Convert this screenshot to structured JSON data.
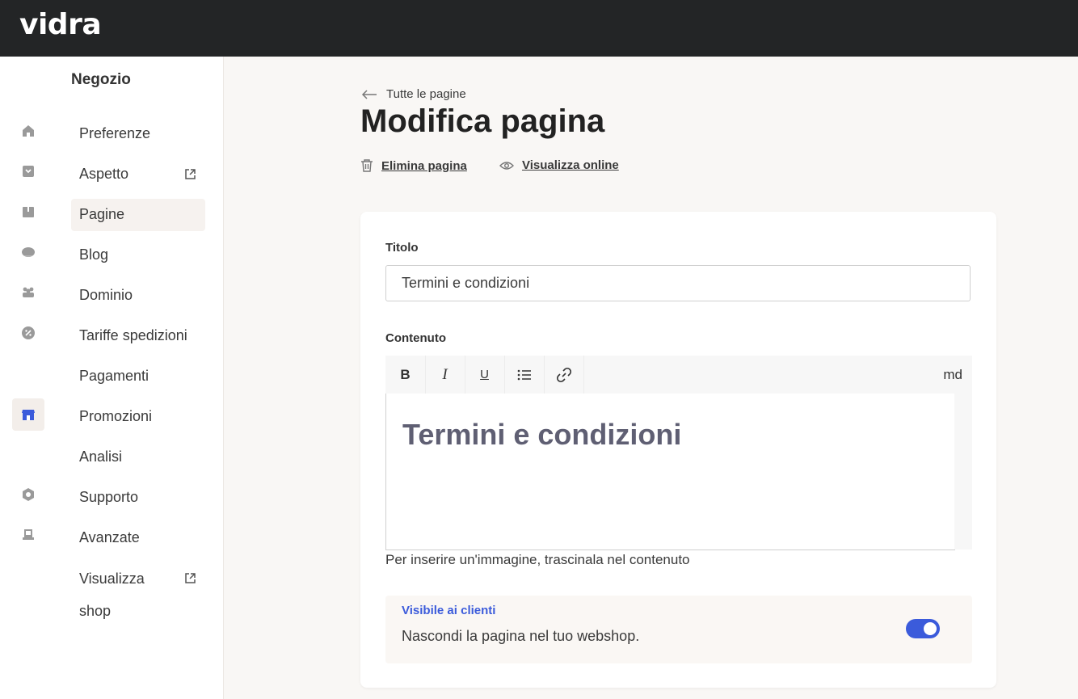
{
  "app": {
    "logo": "vidra"
  },
  "rail": {
    "icons": [
      {
        "name": "home-icon"
      },
      {
        "name": "orders-icon"
      },
      {
        "name": "products-icon"
      },
      {
        "name": "customers-icon"
      },
      {
        "name": "team-icon"
      },
      {
        "name": "discount-icon"
      },
      {
        "name": "store-icon",
        "active": true
      },
      {
        "name": "settings-icon"
      },
      {
        "name": "desk-icon"
      }
    ],
    "accent": "#3b5bdb"
  },
  "sidebar": {
    "title": "Negozio",
    "items": [
      {
        "label": "Preferenze"
      },
      {
        "label": "Aspetto",
        "external": true
      },
      {
        "label": "Pagine",
        "active": true
      },
      {
        "label": "Blog"
      },
      {
        "label": "Dominio"
      },
      {
        "label": "Tariffe spedizioni"
      },
      {
        "label": "Pagamenti"
      },
      {
        "label": "Promozioni"
      },
      {
        "label": "Analisi"
      },
      {
        "label": "Supporto"
      },
      {
        "label": "Avanzate"
      },
      {
        "label": "Visualizza shop",
        "external": true
      }
    ]
  },
  "main": {
    "back_link": "Tutte le pagine",
    "title": "Modifica pagina",
    "actions": {
      "delete": "Elimina pagina",
      "view": "Visualizza online"
    }
  },
  "form": {
    "title_label": "Titolo",
    "title_value": "Termini e condizioni",
    "content_label": "Contenuto",
    "toolbar": {
      "bold": "B",
      "italic": "I",
      "underline": "U",
      "md": "md"
    },
    "content_heading": "Termini e condizioni",
    "hint": "Per inserire un'immagine, trascinala nel contenuto",
    "visibility": {
      "label": "Visibile ai clienti",
      "description": "Nascondi la pagina nel tuo webshop.",
      "enabled": true
    }
  }
}
